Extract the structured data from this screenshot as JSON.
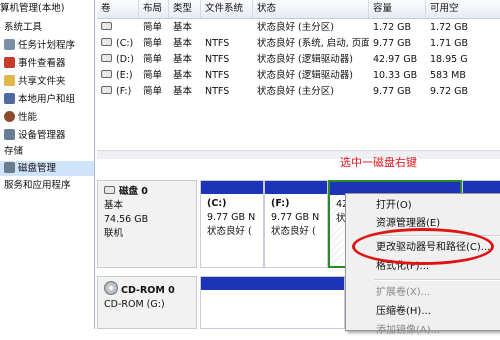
{
  "tree": {
    "items": [
      {
        "label": "算机管理(本地)",
        "color": "#5a6f8f"
      },
      {
        "label": "系统工具",
        "color": "#8a96a8"
      },
      {
        "label": "任务计划程序",
        "color": "#7b8ea8"
      },
      {
        "label": "事件查看器",
        "color": "#c83a2a"
      },
      {
        "label": "共享文件夹",
        "color": "#e0b84a"
      },
      {
        "label": "本地用户和组",
        "color": "#4f6aa0"
      },
      {
        "label": "性能",
        "color": "#8b4a2c"
      },
      {
        "label": "设备管理器",
        "color": "#6a7d96"
      },
      {
        "label": "存储",
        "color": "#8a96a8"
      },
      {
        "label": "磁盘管理",
        "color": "#6b7b8f"
      },
      {
        "label": "服务和应用程序",
        "color": "#8a96a8"
      }
    ]
  },
  "table": {
    "headers": [
      "卷",
      "布局",
      "类型",
      "文件系统",
      "状态",
      "容量",
      "可用空"
    ],
    "rows": [
      [
        "",
        "简单",
        "基本",
        "",
        "状态良好 (主分区)",
        "1.72 GB",
        "1.72 GB"
      ],
      [
        "(C:)",
        "简单",
        "基本",
        "NTFS",
        "状态良好 (系统, 启动, 页面...",
        "9.77 GB",
        "1.71 GB"
      ],
      [
        "(D:)",
        "简单",
        "基本",
        "NTFS",
        "状态良好 (逻辑驱动器)",
        "42.97 GB",
        "18.95 G"
      ],
      [
        "(E:)",
        "简单",
        "基本",
        "NTFS",
        "状态良好 (逻辑驱动器)",
        "10.33 GB",
        "583 MB"
      ],
      [
        "(F:)",
        "简单",
        "基本",
        "NTFS",
        "状态良好 (主分区)",
        "9.77 GB",
        "9.72 GB"
      ]
    ]
  },
  "hint": "选中一磁盘右键",
  "disk0": {
    "title": "磁盘 0",
    "type": "基本",
    "size": "74.56 GB",
    "status": "联机"
  },
  "partitions": [
    {
      "name": "(C:)",
      "size": "9.77 GB N",
      "status": "状态良好 ("
    },
    {
      "name": "(F:)",
      "size": "9.77 GB N",
      "status": "状态良好 ("
    },
    {
      "name": "",
      "size": "42",
      "status": "状"
    }
  ],
  "cdrom": {
    "title": "CD-ROM 0",
    "sub": "CD-ROM (G:)"
  },
  "menu": {
    "items": [
      {
        "label": "打开(O)",
        "disabled": false
      },
      {
        "label": "资源管理器(E)",
        "disabled": false
      },
      {
        "label": "更改驱动器号和路径(C)...",
        "disabled": false
      },
      {
        "label": "格式化(F)...",
        "disabled": false
      },
      {
        "label": "扩展卷(X)...",
        "disabled": true
      },
      {
        "label": "压缩卷(H)...",
        "disabled": false
      },
      {
        "label": "添加镜像(A)...",
        "disabled": true
      }
    ]
  },
  "colors": {
    "partition_bar": "#1d33b8",
    "highlight": "#e01313",
    "selected_partition_border": "#2a8a2a"
  }
}
